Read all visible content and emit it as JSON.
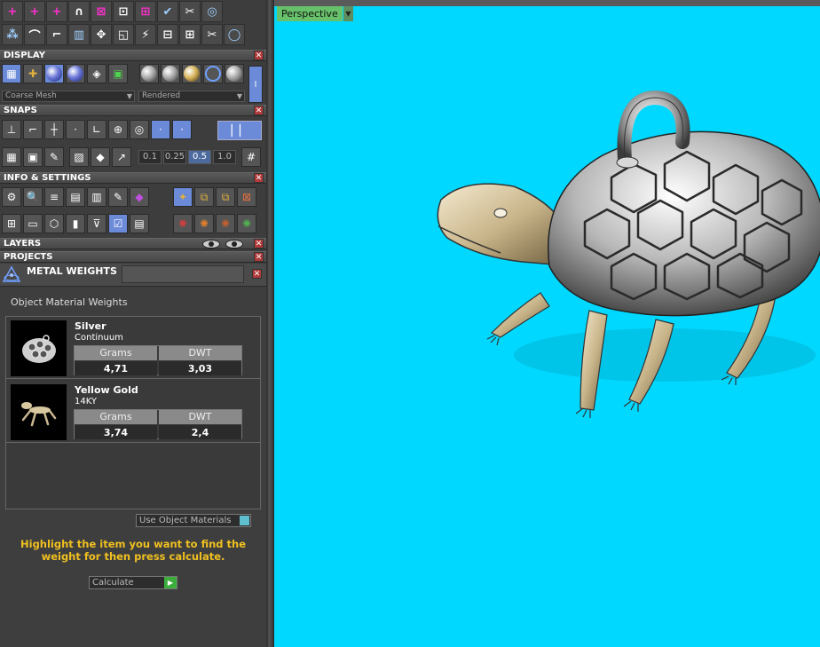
{
  "toolbar_rows": [
    [
      "+",
      "+",
      "+",
      "∩",
      "⊠",
      "⊡",
      "⊞",
      "✔",
      "✂",
      "◎"
    ],
    [
      "⁂",
      "⌒",
      "⌐",
      "▥",
      "✥",
      "◱",
      "⚡",
      "⊟",
      "⊞",
      "✂",
      "◯"
    ]
  ],
  "display": {
    "title": "DISPLAY",
    "mesh_option": "Coarse Mesh",
    "render_option": "Rendered"
  },
  "snaps": {
    "title": "SNAPS",
    "values": [
      "0.1",
      "0.25",
      "0.5",
      "1.0"
    ],
    "active_value": "0.5"
  },
  "info_settings": {
    "title": "INFO & SETTINGS"
  },
  "layers": {
    "title": "LAYERS"
  },
  "projects": {
    "title": "PROJECTS"
  },
  "metal_weights": {
    "title": "METAL WEIGHTS",
    "section_label": "Object Material Weights",
    "col_grams": "Grams",
    "col_dwt": "DWT",
    "items": [
      {
        "name": "Silver",
        "alloy": "Continuum",
        "grams": "4,71",
        "dwt": "3,03"
      },
      {
        "name": "Yellow Gold",
        "alloy": "14KY",
        "grams": "3,74",
        "dwt": "2,4"
      }
    ],
    "use_object_materials": "Use Object Materials",
    "hint": "Highlight the item you want to find the weight for then press calculate.",
    "calculate": "Calculate"
  },
  "viewport": {
    "label": "Perspective",
    "background": "#00d8ff"
  },
  "colors": {
    "panel": "#3d3d3d",
    "hint": "#f0c020",
    "close": "#b13a3a"
  }
}
